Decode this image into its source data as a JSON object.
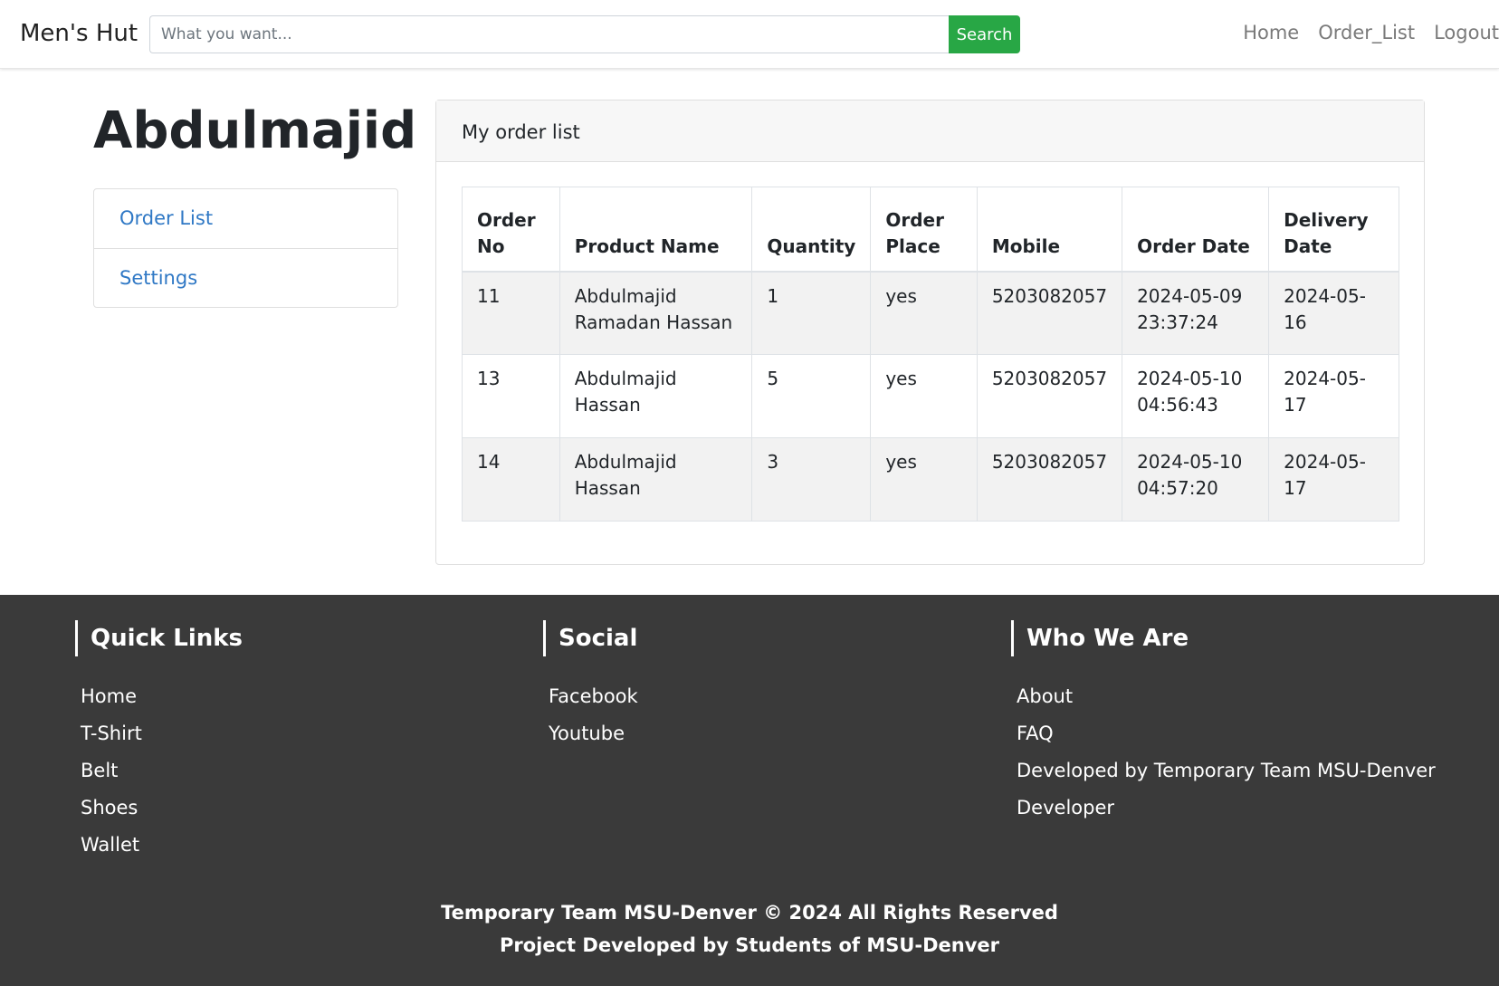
{
  "navbar": {
    "brand": "Men's Hut",
    "search_placeholder": "What you want...",
    "search_label": "Search",
    "links": [
      "Home",
      "Order_List",
      "Logout"
    ]
  },
  "profile": {
    "username": "Abdulmajid",
    "menu": [
      "Order List",
      "Settings"
    ]
  },
  "orders_card": {
    "title": "My order list",
    "columns": [
      "Order No",
      "Product Name",
      "Quantity",
      "Order Place",
      "Mobile",
      "Order Date",
      "Delivery Date"
    ],
    "rows": [
      [
        "11",
        "Abdulmajid Ramadan Hassan",
        "1",
        "yes",
        "5203082057",
        "2024-05-09 23:37:24",
        "2024-05-16"
      ],
      [
        "13",
        "Abdulmajid Hassan",
        "5",
        "yes",
        "5203082057",
        "2024-05-10 04:56:43",
        "2024-05-17"
      ],
      [
        "14",
        "Abdulmajid Hassan",
        "3",
        "yes",
        "5203082057",
        "2024-05-10 04:57:20",
        "2024-05-17"
      ]
    ]
  },
  "footer": {
    "quick_links": {
      "title": "Quick Links",
      "items": [
        "Home",
        "T-Shirt",
        "Belt",
        "Shoes",
        "Wallet"
      ]
    },
    "social": {
      "title": "Social",
      "items": [
        "Facebook",
        "Youtube"
      ]
    },
    "who_we_are": {
      "title": "Who We Are",
      "items": [
        "About",
        "FAQ",
        "Developed by Temporary Team MSU-Denver",
        "Developer"
      ]
    },
    "copyright_line1": "Temporary Team MSU-Denver © 2024 All Rights Reserved",
    "copyright_line2": "Project Developed by Students of MSU-Denver"
  }
}
